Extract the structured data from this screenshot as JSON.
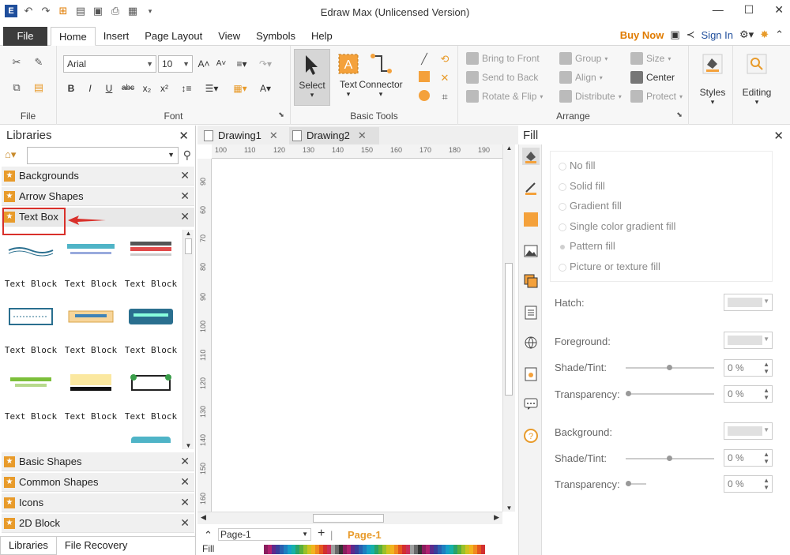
{
  "window": {
    "title": "Edraw Max (Unlicensed Version)"
  },
  "menu": {
    "file": "File",
    "tabs": [
      "Home",
      "Insert",
      "Page Layout",
      "View",
      "Symbols",
      "Help"
    ],
    "buy_now": "Buy Now",
    "sign_in": "Sign In"
  },
  "ribbon": {
    "file_group": "File",
    "font": {
      "name": "Arial",
      "size": "10",
      "group": "Font"
    },
    "basic_tools": {
      "select": "Select",
      "text": "Text",
      "connector": "Connector",
      "group": "Basic Tools"
    },
    "arrange": {
      "bring_to_front": "Bring to Front",
      "send_to_back": "Send to Back",
      "rotate_flip": "Rotate & Flip",
      "group": "Group",
      "align": "Align",
      "distribute": "Distribute",
      "size": "Size",
      "center": "Center",
      "protect": "Protect",
      "label": "Arrange"
    },
    "styles": "Styles",
    "editing": "Editing"
  },
  "libraries": {
    "title": "Libraries",
    "categories_top": [
      "Backgrounds",
      "Arrow Shapes",
      "Text Box"
    ],
    "categories_bottom": [
      "Basic Shapes",
      "Common Shapes",
      "Icons",
      "2D Block"
    ],
    "thumb_caption": "Text Block",
    "bottom_tabs": [
      "Libraries",
      "File Recovery"
    ]
  },
  "documents": {
    "tabs": [
      "Drawing1",
      "Drawing2"
    ]
  },
  "ruler": {
    "h": [
      "100",
      "110",
      "120",
      "130",
      "140",
      "150",
      "160",
      "170",
      "180",
      "190"
    ],
    "v": [
      "90",
      "60",
      "70",
      "80",
      "90",
      "100",
      "110",
      "120",
      "130",
      "140",
      "150",
      "160"
    ]
  },
  "pages": {
    "current": "Page-1",
    "active_tab": "Page-1"
  },
  "fill_strip_label": "Fill",
  "fill_panel": {
    "title": "Fill",
    "options": [
      "No fill",
      "Solid fill",
      "Gradient fill",
      "Single color gradient fill",
      "Pattern fill",
      "Picture or texture fill"
    ],
    "hatch": "Hatch:",
    "foreground": "Foreground:",
    "shade_tint": "Shade/Tint:",
    "transparency": "Transparency:",
    "background": "Background:",
    "percent": "0 %"
  },
  "colors": {
    "accent": "#e89b2b",
    "file_btn": "#3c3c3c",
    "highlight": "#d9302a",
    "buy_now": "#e07b00"
  }
}
